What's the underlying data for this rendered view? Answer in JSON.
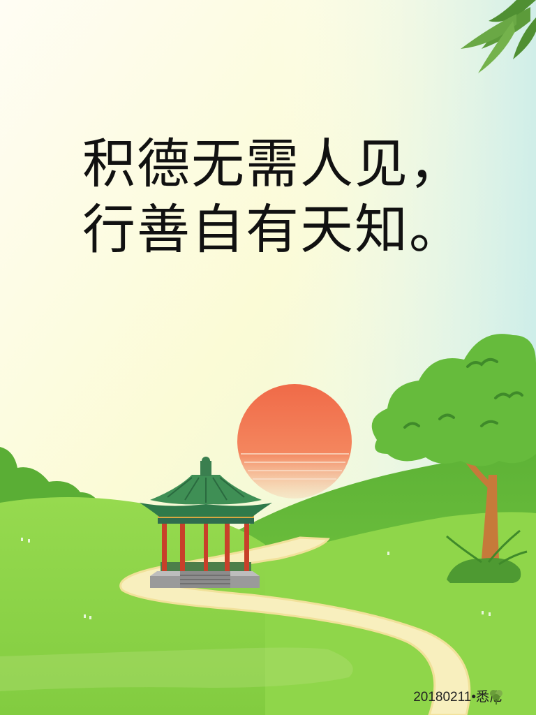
{
  "poem": {
    "line1": "积德无需人见，",
    "line2": "行善自有天知。"
  },
  "caption": {
    "text": "20180211•悉尼",
    "icon": "clover-icon"
  },
  "colors": {
    "sky_top": "#fffdf2",
    "sky_mid": "#f7f9c8",
    "sky_right": "#cdeef0",
    "sun": "#f07a52",
    "hill_back": "#6cbf3a",
    "hill_front": "#8fd64a",
    "path": "#f8efbe",
    "tree_leaves": "#66bb3c",
    "trunk": "#c67a3a",
    "roof": "#3f8f55",
    "pillar": "#c8402a",
    "text": "#111111"
  }
}
